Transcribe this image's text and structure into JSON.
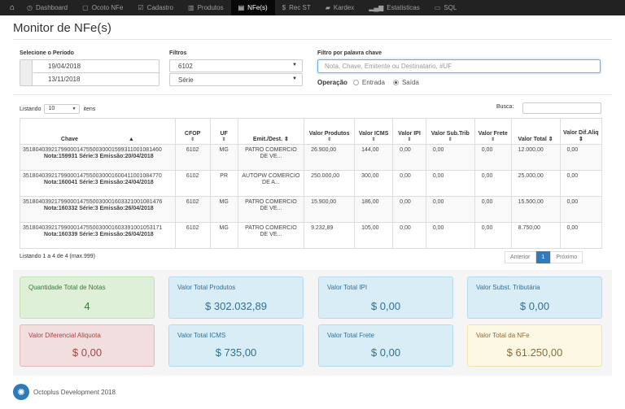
{
  "nav": {
    "items": [
      {
        "icon": "◷",
        "label": "Dashboard",
        "name": "nav-dashboard"
      },
      {
        "icon": "▢",
        "label": "Ocoto NFe",
        "name": "nav-ocoto-nfe"
      },
      {
        "icon": "☑",
        "label": "Cadastro",
        "name": "nav-cadastro"
      },
      {
        "icon": "▥",
        "label": "Produtos",
        "name": "nav-produtos"
      },
      {
        "icon": "▤",
        "label": "NFe(s)",
        "name": "nav-nfes",
        "active": true
      },
      {
        "icon": "$",
        "label": "Rec ST",
        "name": "nav-rec-st"
      },
      {
        "icon": "▰",
        "label": "Kardex",
        "name": "nav-kardex"
      },
      {
        "icon": "▂▄▆",
        "label": "Estatisticas",
        "name": "nav-estatisticas"
      },
      {
        "icon": "▭",
        "label": "SQL",
        "name": "nav-sql"
      }
    ]
  },
  "page": {
    "title": "Monitor de NFe(s)"
  },
  "filters": {
    "period_label": "Selecione o Período",
    "date_from": "19/04/2018",
    "date_to": "13/11/2018",
    "filtros_label": "Filtros",
    "cfop_value": "6102",
    "serie_value": "Série",
    "keyword_label": "Filtro por palavra chave",
    "keyword_placeholder": "Nota, Chave, Emitente ou Destinatario, #UF",
    "operacao_label": "Operação",
    "entrada_label": "Entrada",
    "saida_label": "Saída"
  },
  "table_controls": {
    "listando": "Listando",
    "page_size": "10",
    "itens": "itens",
    "busca_label": "Busca:"
  },
  "table": {
    "headers": [
      "Chave",
      "CFOP",
      "UF",
      "Emit./Dest.",
      "Valor Produtos",
      "Valor ICMS",
      "Valor IPI",
      "Valor Sub.Trib",
      "Valor Frete",
      "Valor Total",
      "Valor Dif.Aliq"
    ],
    "rows": [
      {
        "chave": "35180403921799000147550030001599311001081460",
        "nota": "Nota:159931  Série:3  Emissão:20/04/2018",
        "cfop": "6102",
        "uf": "MG",
        "emit": "PATRO COMERCIO DE VE...",
        "prod": "26.900,00",
        "icms": "144,00",
        "ipi": "0,00",
        "st": "0,00",
        "frete": "0,00",
        "total": "12.000,00",
        "dif": "0,00"
      },
      {
        "chave": "35180403921799000147550030001600411001084770",
        "nota": "Nota:160041  Série:3  Emissão:24/04/2018",
        "cfop": "6102",
        "uf": "PR",
        "emit": "AUTOPW COMERCIO DE A...",
        "prod": "250.000,00",
        "icms": "300,00",
        "ipi": "0,00",
        "st": "0,00",
        "frete": "0,00",
        "total": "25.000,00",
        "dif": "0,00"
      },
      {
        "chave": "35180403921799000147550030001603321001081476",
        "nota": "Nota:160332  Série:3  Emissão:26/04/2018",
        "cfop": "6102",
        "uf": "MG",
        "emit": "PATRO COMERCIO DE VE...",
        "prod": "15.900,00",
        "icms": "186,00",
        "ipi": "0,00",
        "st": "0,00",
        "frete": "0,00",
        "total": "15.500,00",
        "dif": "0,00"
      },
      {
        "chave": "35180403921799000147550030001603391001053171",
        "nota": "Nota:160339  Série:3  Emissão:26/04/2018",
        "cfop": "6102",
        "uf": "MG",
        "emit": "PATRO COMERCIO DE VE...",
        "prod": "9.232,89",
        "icms": "105,00",
        "ipi": "0,00",
        "st": "0,00",
        "frete": "0,00",
        "total": "8.750,00",
        "dif": "0,00"
      }
    ]
  },
  "table_footer": {
    "count_text": "Listando 1 a 4 de 4 (max.999)",
    "prev": "Anterior",
    "page": "1",
    "next": "Próximo"
  },
  "summary": {
    "qtd_label": "Quantidade Total de Notas",
    "qtd_value": "4",
    "prod_label": "Valor Total Produtos",
    "prod_value": "$ 302.032,89",
    "ipi_label": "Valor Total IPI",
    "ipi_value": "$ 0,00",
    "st_label": "Valor Subst. Tributária",
    "st_value": "$ 0,00",
    "dif_label": "Valor Diferencial Aliquota",
    "dif_value": "$ 0,00",
    "icms_label": "Valor Total ICMS",
    "icms_value": "$ 735,00",
    "frete_label": "Valor Total Frete",
    "frete_value": "$ 0,00",
    "nfe_label": "Valor Total da NFe",
    "nfe_value": "$ 61.250,00"
  },
  "footer": {
    "brand": "Octoplus Development 2018"
  },
  "colors": {
    "navbar": "#222222",
    "primary": "#337ab7",
    "success_bg": "#dff0d8",
    "info_bg": "#d9edf7",
    "danger_bg": "#f2dede",
    "warning_bg": "#fcf8e3"
  }
}
